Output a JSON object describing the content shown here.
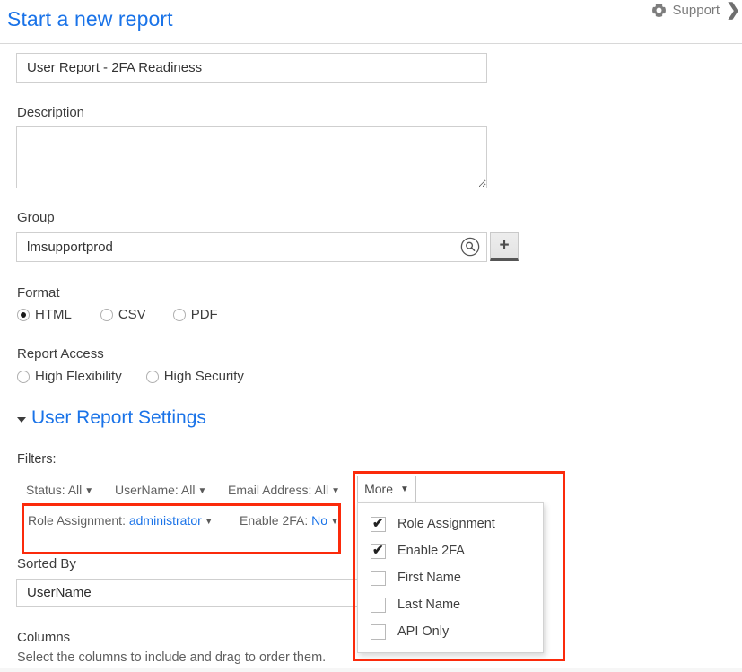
{
  "header": {
    "title": "Start a new report",
    "support_label": "Support",
    "support_icon": "lifebuoy-icon",
    "chevron_icon": "chevron-right-icon"
  },
  "form": {
    "name_value": "User Report - 2FA Readiness",
    "name_placeholder": "",
    "description_label": "Description",
    "description_value": "",
    "description_placeholder": "",
    "group_label": "Group",
    "group_value": "lmsupportprod",
    "group_placeholder": "",
    "group_search_icon": "search-icon",
    "group_add_label": "+",
    "format_label": "Format",
    "format_options": [
      {
        "label": "HTML",
        "selected": true
      },
      {
        "label": "CSV",
        "selected": false
      },
      {
        "label": "PDF",
        "selected": false
      }
    ],
    "access_label": "Report Access",
    "access_options": [
      {
        "label": "High Flexibility",
        "selected": false
      },
      {
        "label": "High Security",
        "selected": false
      }
    ]
  },
  "settings": {
    "section_title": "User Report Settings",
    "section_caret": "caret-down-icon",
    "filters_label": "Filters:",
    "filters_row1": [
      {
        "name": "Status",
        "value": "All",
        "highlight": false
      },
      {
        "name": "UserName",
        "value": "All",
        "highlight": false
      },
      {
        "name": "Email Address",
        "value": "All",
        "highlight": false
      }
    ],
    "filters_row2": [
      {
        "name": "Role Assignment",
        "value": "administrator",
        "highlight": true
      },
      {
        "name": "Enable 2FA",
        "value": "No",
        "highlight": true
      }
    ],
    "more_button_label": "More",
    "more_caret": "caret-down-icon",
    "more_menu_items": [
      {
        "label": "Role Assignment",
        "checked": true
      },
      {
        "label": "Enable 2FA",
        "checked": true
      },
      {
        "label": "First Name",
        "checked": false
      },
      {
        "label": "Last Name",
        "checked": false
      },
      {
        "label": "API Only",
        "checked": false
      }
    ],
    "sorted_by_label": "Sorted By",
    "sorted_by_value": "UserName",
    "columns_label": "Columns",
    "columns_help": "Select the columns to include and drag to order them."
  },
  "colors": {
    "link": "#1a73e8",
    "annotation": "#fb2a0b",
    "text": "#3c3c3c"
  }
}
